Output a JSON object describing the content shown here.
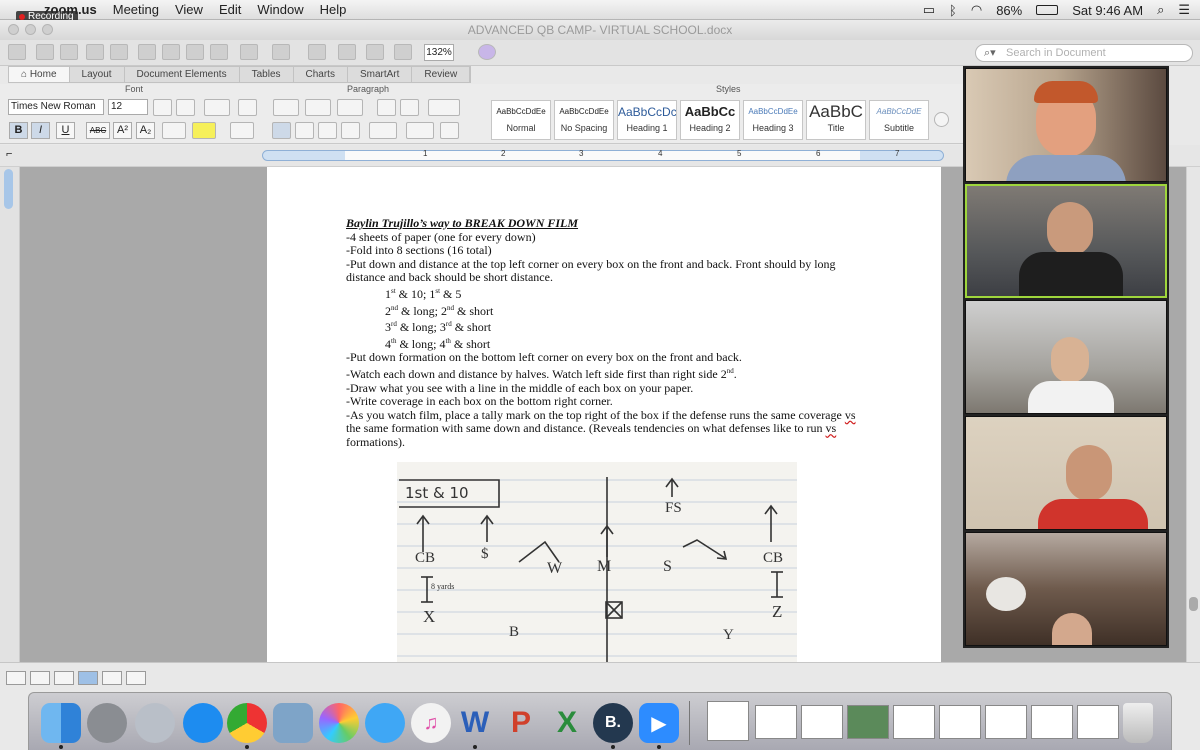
{
  "menubar": {
    "app_name": "zoom.us",
    "menus": [
      "Meeting",
      "View",
      "Edit",
      "Window",
      "Help"
    ],
    "recording_label": "Recording",
    "battery": "86%",
    "clock": "Sat 9:46 AM"
  },
  "window": {
    "title": "ADVANCED QB CAMP- VIRTUAL SCHOOL.docx"
  },
  "toolbar": {
    "zoom": "132%",
    "search_placeholder": "Search in Document"
  },
  "ribbon": {
    "tabs": [
      "Home",
      "Layout",
      "Document Elements",
      "Tables",
      "Charts",
      "SmartArt",
      "Review"
    ],
    "active_tab": "Home",
    "groups": {
      "font": "Font",
      "paragraph": "Paragraph",
      "styles": "Styles"
    },
    "font_name": "Times New Roman",
    "font_size": "12",
    "format_buttons": [
      "B",
      "I",
      "U",
      "ABC",
      "A²",
      "A₂"
    ],
    "styles": [
      {
        "sample": "AaBbCcDdEe",
        "name": "Normal"
      },
      {
        "sample": "AaBbCcDdEe",
        "name": "No Spacing"
      },
      {
        "sample": "AaBbCcDc",
        "name": "Heading 1"
      },
      {
        "sample": "AaBbCc",
        "name": "Heading 2"
      },
      {
        "sample": "AaBbCcDdEe",
        "name": "Heading 3"
      },
      {
        "sample": "AaBbC",
        "name": "Title"
      },
      {
        "sample": "AaBbCcDdE",
        "name": "Subtitle"
      }
    ]
  },
  "ruler": {
    "numbers": [
      "1",
      "2",
      "3",
      "4",
      "5",
      "6",
      "7"
    ]
  },
  "document": {
    "title": "Baylin Trujillo’s way to BREAK DOWN FILM",
    "line1": "-4 sheets of paper (one for every down)",
    "line2": "-Fold into 8 sections (16 total)",
    "line3": "-Put down and distance at the top left corner on every box on the front and back. Front should by long distance and back should be short distance.",
    "down1_a": "1",
    "down1_a_sup": "st",
    "down1_b": " & 10; 1",
    "down1_b_sup": "st",
    "down1_c": " & 5",
    "down2_a": "2",
    "down2_a_sup": "nd",
    "down2_b": " & long; 2",
    "down2_b_sup": "nd",
    "down2_c": " & short",
    "down3_a": "3",
    "down3_a_sup": "rd",
    "down3_b": " & long; 3",
    "down3_b_sup": "rd",
    "down3_c": " & short",
    "down4_a": "4",
    "down4_a_sup": "th",
    "down4_b": " & long; 4",
    "down4_b_sup": "th",
    "down4_c": " & short",
    "line4": "-Put down formation on the bottom left corner on every box on the front and back.",
    "line5_a": "-Watch each down and distance by halves. Watch left side first than right side 2",
    "line5_sup": "nd",
    "line5_b": ".",
    "line6": "-Draw what you see with a line in the middle of each box on your paper.",
    "line7": "-Write coverage in each box on the bottom right corner.",
    "line8_a": "-As you watch film, place a tally mark on the top right of the box if the defense runs the same coverage ",
    "line8_vs": "vs",
    "line8_b": " the same formation with same down and distance. (Reveals tendencies on what defenses like to run ",
    "line8_vs2": "vs",
    "line8_c": " formations).",
    "sketch": {
      "box_label": "1st & 10",
      "labels": [
        "FS",
        "CB",
        "$",
        "W",
        "M",
        "S",
        "CB",
        "X",
        "Z",
        "B",
        "Y"
      ],
      "cushion_note": "8 yards"
    }
  },
  "dock": {
    "apps": [
      "finder-icon",
      "system-preferences-icon",
      "launchpad-icon",
      "app-store-icon",
      "chrome-icon",
      "mail-icon",
      "photos-icon",
      "messages-icon",
      "itunes-icon",
      "word-icon",
      "powerpoint-icon",
      "excel-icon",
      "b-app-icon",
      "zoom-icon"
    ],
    "app_letters": {
      "word": "W",
      "powerpoint": "P",
      "excel": "X",
      "b_app": "B."
    }
  }
}
